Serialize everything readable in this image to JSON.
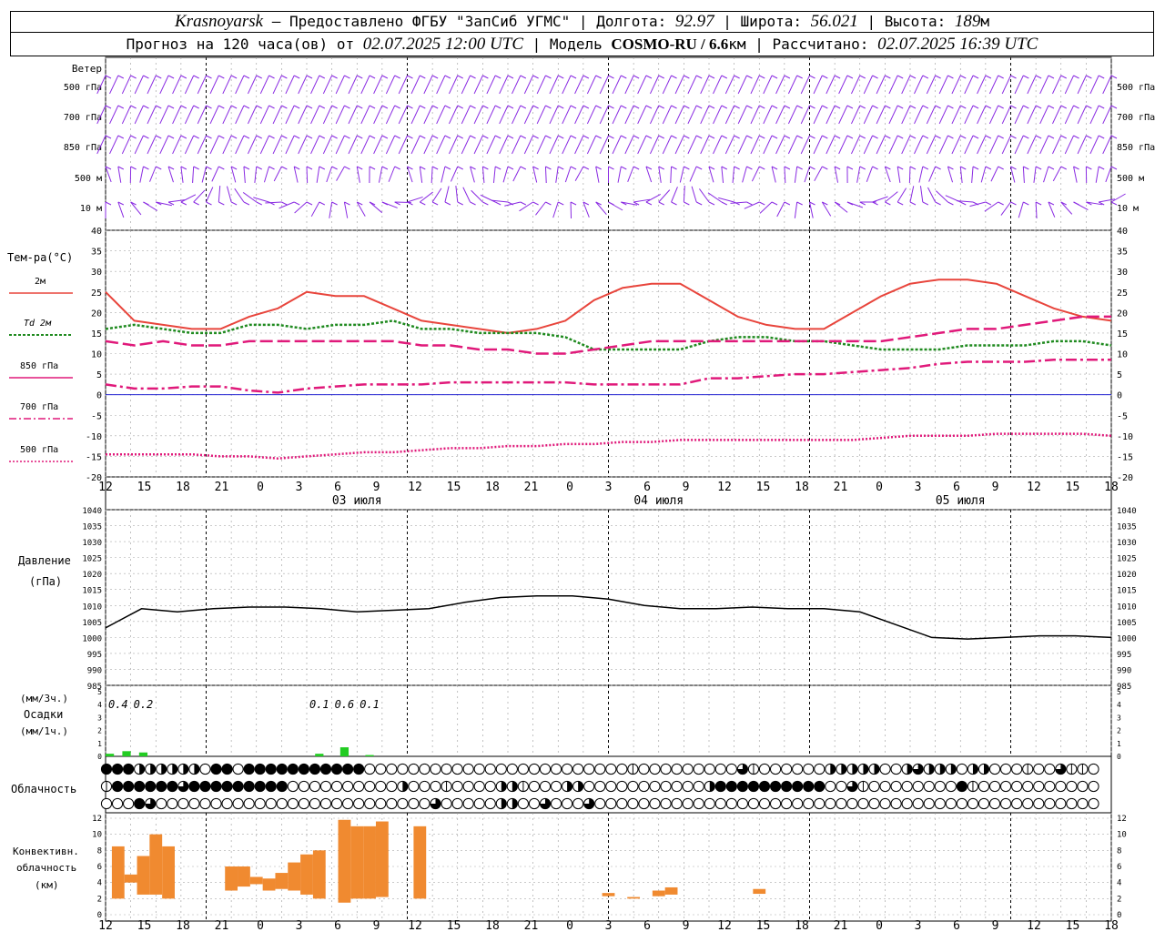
{
  "header": {
    "city": "Krasnoyarsk",
    "provider": "— Предоставлено ФГБУ \"ЗапСиб УГМС\" |",
    "lon_label": "Долгота:",
    "lon_value": "92.97",
    "lat_label": "| Широта:",
    "lat_value": "56.021",
    "alt_label": "| Высота:",
    "alt_value": "189",
    "alt_unit": "м",
    "fc_prefix": "Прогноз на 120 часа(ов) от",
    "fc_start": "02.07.2025 12:00 UTC",
    "model_label": "| Модель",
    "model_name": "COSMO-RU / 6.6",
    "model_unit": "км",
    "calc_label": "| Рассчитано:",
    "calc_time": "02.07.2025 16:39 UTC"
  },
  "labels": {
    "wind": "Ветер",
    "wind_levels": [
      "500 гПа",
      "700 гПа",
      "850 гПа",
      "500 м",
      "10 м"
    ],
    "temp": "Тем-ра(°C)",
    "temp_legend": [
      "2м",
      "Td 2м",
      "850 гПа",
      "700 гПа",
      "500 гПа"
    ],
    "pressure": [
      "Давление",
      "(гПа)"
    ],
    "precip": [
      "(мм/3ч.)",
      "Осадки",
      "(мм/1ч.)"
    ],
    "cloud": "Облачность",
    "conv": [
      "Конвективн.",
      "облачность",
      "(км)"
    ]
  },
  "colors": {
    "t2m": "#e8453c",
    "td2m": "#1f8a1f",
    "t850": "#e0197a",
    "t700": "#e0197a",
    "t500": "#e0197a",
    "wind": "#8a2be2",
    "zero": "#0000cc",
    "precip": "#22cc22",
    "conv": "#f08a30"
  },
  "chart_data": {
    "type": "line",
    "x_ticks": [
      "12",
      "15",
      "18",
      "21",
      "0",
      "3",
      "6",
      "9",
      "12",
      "15",
      "18",
      "21",
      "0",
      "3",
      "6",
      "9",
      "12",
      "15",
      "18",
      "21",
      "0",
      "3",
      "6",
      "9",
      "12",
      "15",
      "18"
    ],
    "dates": [
      "03 июля",
      "04 июля",
      "05 июля"
    ],
    "temperature": {
      "ylim": [
        -20,
        40
      ],
      "ticks": [
        "40",
        "35",
        "30",
        "25",
        "20",
        "15",
        "10",
        "5",
        "0",
        "-5",
        "-10",
        "-15",
        "-20"
      ],
      "x_hours": [
        0,
        3,
        6,
        9,
        12,
        15,
        18,
        21,
        24,
        27,
        30,
        33,
        36,
        39,
        42,
        45,
        48,
        51,
        54,
        57,
        60,
        63,
        66,
        69,
        72,
        75,
        78,
        81,
        84,
        87,
        90,
        93,
        96,
        99,
        102,
        105,
        108,
        111,
        114,
        117,
        120
      ],
      "series": [
        {
          "key": "t2m",
          "values": [
            25,
            18,
            17,
            16,
            16,
            19,
            21,
            25,
            24,
            24,
            21,
            18,
            17,
            16,
            15,
            16,
            18,
            23,
            26,
            27,
            27,
            23,
            19,
            17,
            16,
            16,
            20,
            24,
            27,
            28,
            28,
            27,
            24,
            21,
            19,
            18
          ]
        },
        {
          "key": "td2m",
          "values": [
            16,
            17,
            16,
            15,
            15,
            17,
            17,
            16,
            17,
            17,
            18,
            16,
            16,
            15,
            15,
            15,
            14,
            11,
            11,
            11,
            11,
            13,
            14,
            14,
            13,
            13,
            12,
            11,
            11,
            11,
            12,
            12,
            12,
            13,
            13,
            12
          ]
        },
        {
          "key": "t850",
          "values": [
            13,
            12,
            13,
            12,
            12,
            13,
            13,
            13,
            13,
            13,
            13,
            12,
            12,
            11,
            11,
            10,
            10,
            11,
            12,
            13,
            13,
            13,
            13,
            13,
            13,
            13,
            13,
            13,
            14,
            15,
            16,
            16,
            17,
            18,
            19,
            19
          ]
        },
        {
          "key": "t700",
          "values": [
            2.5,
            1.5,
            1.5,
            2,
            2,
            1,
            0.5,
            1.5,
            2,
            2.5,
            2.5,
            2.5,
            3,
            3,
            3,
            3,
            3,
            2.5,
            2.5,
            2.5,
            2.5,
            4,
            4,
            4.5,
            5,
            5,
            5.5,
            6,
            6.5,
            7.5,
            8,
            8,
            8,
            8.5,
            8.5,
            8.5
          ]
        },
        {
          "key": "t500",
          "values": [
            -14.5,
            -14.5,
            -14.5,
            -14.5,
            -15,
            -15,
            -15.5,
            -15,
            -14.5,
            -14,
            -14,
            -13.5,
            -13,
            -13,
            -12.5,
            -12.5,
            -12,
            -12,
            -11.5,
            -11.5,
            -11,
            -11,
            -11,
            -11,
            -11,
            -11,
            -11,
            -10.5,
            -10,
            -10,
            -10,
            -9.5,
            -9.5,
            -9.5,
            -9.5,
            -10
          ]
        }
      ]
    },
    "pressure": {
      "ylim": [
        985,
        1040
      ],
      "ticks": [
        "1040",
        "1035",
        "1030",
        "1025",
        "1020",
        "1015",
        "1010",
        "1005",
        "1000",
        "995",
        "990",
        "985"
      ],
      "values": [
        1003,
        1009,
        1008,
        1009,
        1009.5,
        1009.5,
        1009,
        1008,
        1008.5,
        1009,
        1011,
        1012.5,
        1013,
        1013,
        1012,
        1010,
        1009,
        1009,
        1009.5,
        1009,
        1009,
        1008,
        1004,
        1000,
        999.5,
        1000,
        1000.5,
        1000.5,
        1000
      ]
    },
    "precip": {
      "ylim": [
        0,
        5
      ],
      "ticks": [
        "5",
        "4",
        "3",
        "2",
        "1",
        "0"
      ],
      "labels": [
        {
          "hour": 1.5,
          "text": "0.4"
        },
        {
          "hour": 4.5,
          "text": "0.2"
        },
        {
          "hour": 25.5,
          "text": "0.1"
        },
        {
          "hour": 28.5,
          "text": "0.6"
        },
        {
          "hour": 31.5,
          "text": "0.1"
        }
      ],
      "hourly": [
        {
          "hour": 0.5,
          "mm": 0.2
        },
        {
          "hour": 2.5,
          "mm": 0.4
        },
        {
          "hour": 4.5,
          "mm": 0.3
        },
        {
          "hour": 25.5,
          "mm": 0.2
        },
        {
          "hour": 28.5,
          "mm": 0.7
        },
        {
          "hour": 31.5,
          "mm": 0.1
        }
      ]
    },
    "cloud_rows": [
      "4442222220440444444444440000000000000000000000001000000000310000002222200232220220001003110",
      "1444444344444444400000000002000100002210002200000000000244444444440031000000004100000000000",
      "0004300000000000000000000000003000002200300030000000000000000000000000000000000000000000000"
    ],
    "convective": {
      "ylim": [
        0,
        12
      ],
      "ticks": [
        "12",
        "10",
        "8",
        "6",
        "4",
        "2",
        "0"
      ],
      "bars": [
        [
          0,
          1,
          2,
          8.5
        ],
        [
          1,
          2,
          4,
          5
        ],
        [
          2,
          3,
          2.5,
          7.3
        ],
        [
          3,
          4,
          2.5,
          10
        ],
        [
          4,
          5,
          2,
          8.5
        ],
        [
          9,
          10,
          3,
          6
        ],
        [
          10,
          11,
          3.5,
          6
        ],
        [
          11,
          12,
          3.8,
          4.7
        ],
        [
          12,
          13,
          3,
          4.5
        ],
        [
          13,
          14,
          3.2,
          5.2
        ],
        [
          14,
          15,
          3,
          6.5
        ],
        [
          15,
          16,
          2.5,
          7.5
        ],
        [
          16,
          17,
          2,
          8
        ],
        [
          18,
          19,
          1.5,
          11.8
        ],
        [
          19,
          20,
          2,
          11
        ],
        [
          20,
          21,
          2,
          11
        ],
        [
          21,
          22,
          2.2,
          11.6
        ],
        [
          24,
          25,
          2,
          11
        ],
        [
          39,
          40,
          2.3,
          2.7
        ],
        [
          41,
          42,
          2,
          2.2
        ],
        [
          43,
          44,
          2.3,
          3
        ],
        [
          44,
          45,
          2.5,
          3.4
        ],
        [
          51,
          52,
          2.6,
          3.2
        ]
      ]
    }
  }
}
